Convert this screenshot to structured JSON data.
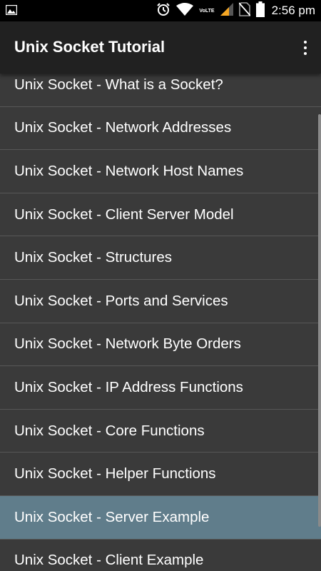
{
  "status_bar": {
    "time": "2:56 pm",
    "network_label": "VoLTE",
    "icons": [
      "image-icon",
      "alarm-icon",
      "wifi-icon",
      "signal-icon",
      "no-sim-icon",
      "battery-icon"
    ]
  },
  "app_bar": {
    "title": "Unix Socket Tutorial",
    "menu_icon": "overflow-menu-icon"
  },
  "list": {
    "items": [
      {
        "label": "Unix Socket - What is a Socket?"
      },
      {
        "label": "Unix Socket - Network Addresses"
      },
      {
        "label": "Unix Socket - Network Host Names"
      },
      {
        "label": "Unix Socket - Client Server Model"
      },
      {
        "label": "Unix Socket - Structures"
      },
      {
        "label": "Unix Socket - Ports and Services"
      },
      {
        "label": "Unix Socket - Network Byte Orders"
      },
      {
        "label": "Unix Socket - IP Address Functions"
      },
      {
        "label": "Unix Socket - Core Functions"
      },
      {
        "label": "Unix Socket - Helper Functions"
      },
      {
        "label": "Unix Socket - Server Example"
      },
      {
        "label": "Unix Socket - Client Example"
      }
    ],
    "selected_index": 10
  },
  "colors": {
    "status_bar": "#000000",
    "app_bar": "#212121",
    "list_background": "#3a3a3a",
    "selected_row": "#607d8b",
    "divider": "#575757",
    "signal_accent": "#f5a623"
  }
}
